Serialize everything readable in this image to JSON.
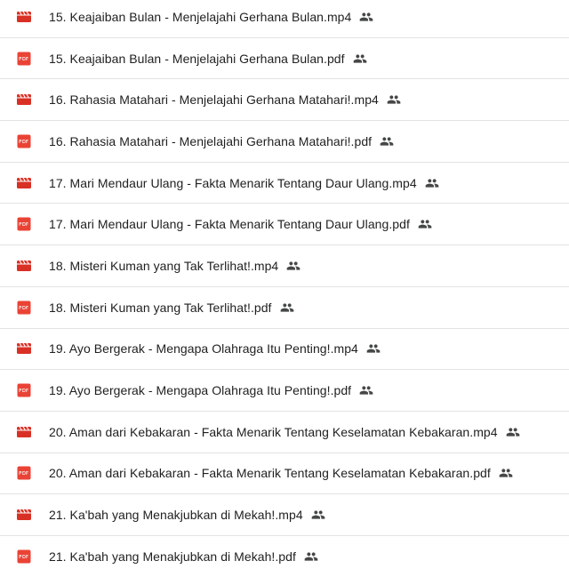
{
  "colors": {
    "video_icon": "#d93025",
    "pdf_icon": "#ea4335",
    "shared_icon": "#444746",
    "text": "#1f1f1f",
    "divider": "#e2e3e5"
  },
  "files": [
    {
      "name": "15. Keajaiban Bulan - Menjelajahi Gerhana Bulan.mp4",
      "type": "video",
      "icon": "video-icon",
      "shared": true
    },
    {
      "name": "15. Keajaiban Bulan - Menjelajahi Gerhana Bulan.pdf",
      "type": "pdf",
      "icon": "pdf-icon",
      "shared": true
    },
    {
      "name": "16. Rahasia Matahari - Menjelajahi Gerhana Matahari!.mp4",
      "type": "video",
      "icon": "video-icon",
      "shared": true
    },
    {
      "name": "16. Rahasia Matahari - Menjelajahi Gerhana Matahari!.pdf",
      "type": "pdf",
      "icon": "pdf-icon",
      "shared": true
    },
    {
      "name": "17. Mari Mendaur Ulang - Fakta Menarik Tentang Daur Ulang.mp4",
      "type": "video",
      "icon": "video-icon",
      "shared": true
    },
    {
      "name": "17. Mari Mendaur Ulang - Fakta Menarik Tentang Daur Ulang.pdf",
      "type": "pdf",
      "icon": "pdf-icon",
      "shared": true
    },
    {
      "name": "18. Misteri Kuman yang Tak Terlihat!.mp4",
      "type": "video",
      "icon": "video-icon",
      "shared": true
    },
    {
      "name": "18. Misteri Kuman yang Tak Terlihat!.pdf",
      "type": "pdf",
      "icon": "pdf-icon",
      "shared": true
    },
    {
      "name": "19. Ayo Bergerak - Mengapa Olahraga Itu Penting!.mp4",
      "type": "video",
      "icon": "video-icon",
      "shared": true
    },
    {
      "name": "19. Ayo Bergerak - Mengapa Olahraga Itu Penting!.pdf",
      "type": "pdf",
      "icon": "pdf-icon",
      "shared": true
    },
    {
      "name": "20. Aman dari Kebakaran - Fakta Menarik Tentang Keselamatan Kebakaran.mp4",
      "type": "video",
      "icon": "video-icon",
      "shared": true
    },
    {
      "name": "20. Aman dari Kebakaran - Fakta Menarik Tentang Keselamatan Kebakaran.pdf",
      "type": "pdf",
      "icon": "pdf-icon",
      "shared": true
    },
    {
      "name": "21. Ka'bah yang Menakjubkan di Mekah!.mp4",
      "type": "video",
      "icon": "video-icon",
      "shared": true
    },
    {
      "name": "21. Ka'bah yang Menakjubkan di Mekah!.pdf",
      "type": "pdf",
      "icon": "pdf-icon",
      "shared": true
    }
  ]
}
